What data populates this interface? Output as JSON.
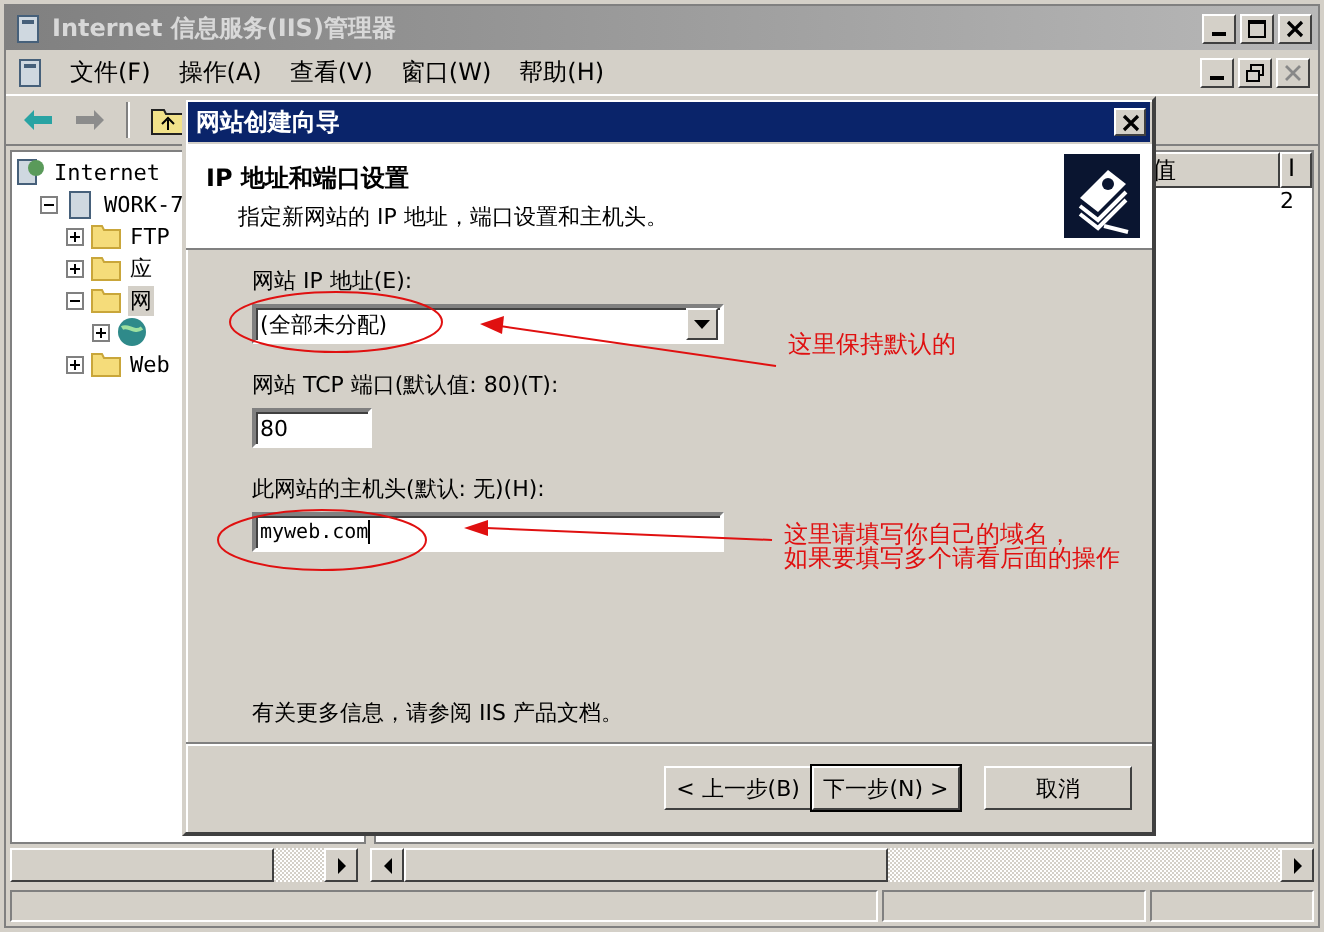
{
  "window": {
    "title": "Internet 信息服务(IIS)管理器"
  },
  "menu": [
    "文件(F)",
    "操作(A)",
    "查看(V)",
    "窗口(W)",
    "帮助(H)"
  ],
  "tree": [
    {
      "label": "Internet",
      "kind": "root",
      "children": [
        {
          "label": "WORK-7",
          "kind": "server",
          "expanded": true,
          "selected": false,
          "children": [
            {
              "label": "FTP",
              "kind": "folder",
              "expanded": false,
              "selected": false
            },
            {
              "label": "应",
              "kind": "folder",
              "expanded": false,
              "selected": false
            },
            {
              "label": "网",
              "kind": "folder",
              "expanded": true,
              "selected": true,
              "children": [
                {
                  "kind": "site",
                  "expanded": false,
                  "selected": false
                }
              ]
            },
            {
              "label": "Web",
              "kind": "folder",
              "expanded": false,
              "selected": false
            }
          ]
        }
      ]
    }
  ],
  "list": {
    "columns": [
      "值",
      "I"
    ],
    "rows": [
      [
        "",
        "2"
      ]
    ]
  },
  "dialog": {
    "title": "网站创建向导",
    "heading": "IP 地址和端口设置",
    "subtitle": "指定新网站的 IP 地址，端口设置和主机头。",
    "fields": [
      {
        "kind": "dropdown",
        "label": "网站 IP 地址(E):",
        "value": "(全部未分配)"
      },
      {
        "kind": "short",
        "label": "网站 TCP 端口(默认值: 80)(T):",
        "value": "80"
      },
      {
        "kind": "text",
        "label": "此网站的主机头(默认: 无)(H):",
        "value": "myweb.com"
      }
    ],
    "info": "有关更多信息，请参阅 IIS 产品文档。",
    "buttons": [
      {
        "label": "< 上一步(B)",
        "default": false
      },
      {
        "label": "下一步(N) >",
        "default": true
      },
      {
        "label": "取消",
        "default": false
      }
    ]
  },
  "annotations": [
    {
      "lines": [
        "这里保持默认的"
      ]
    },
    {
      "lines": [
        "这里请填写你自己的域名，",
        "如果要填写多个请看后面的操作"
      ]
    }
  ]
}
